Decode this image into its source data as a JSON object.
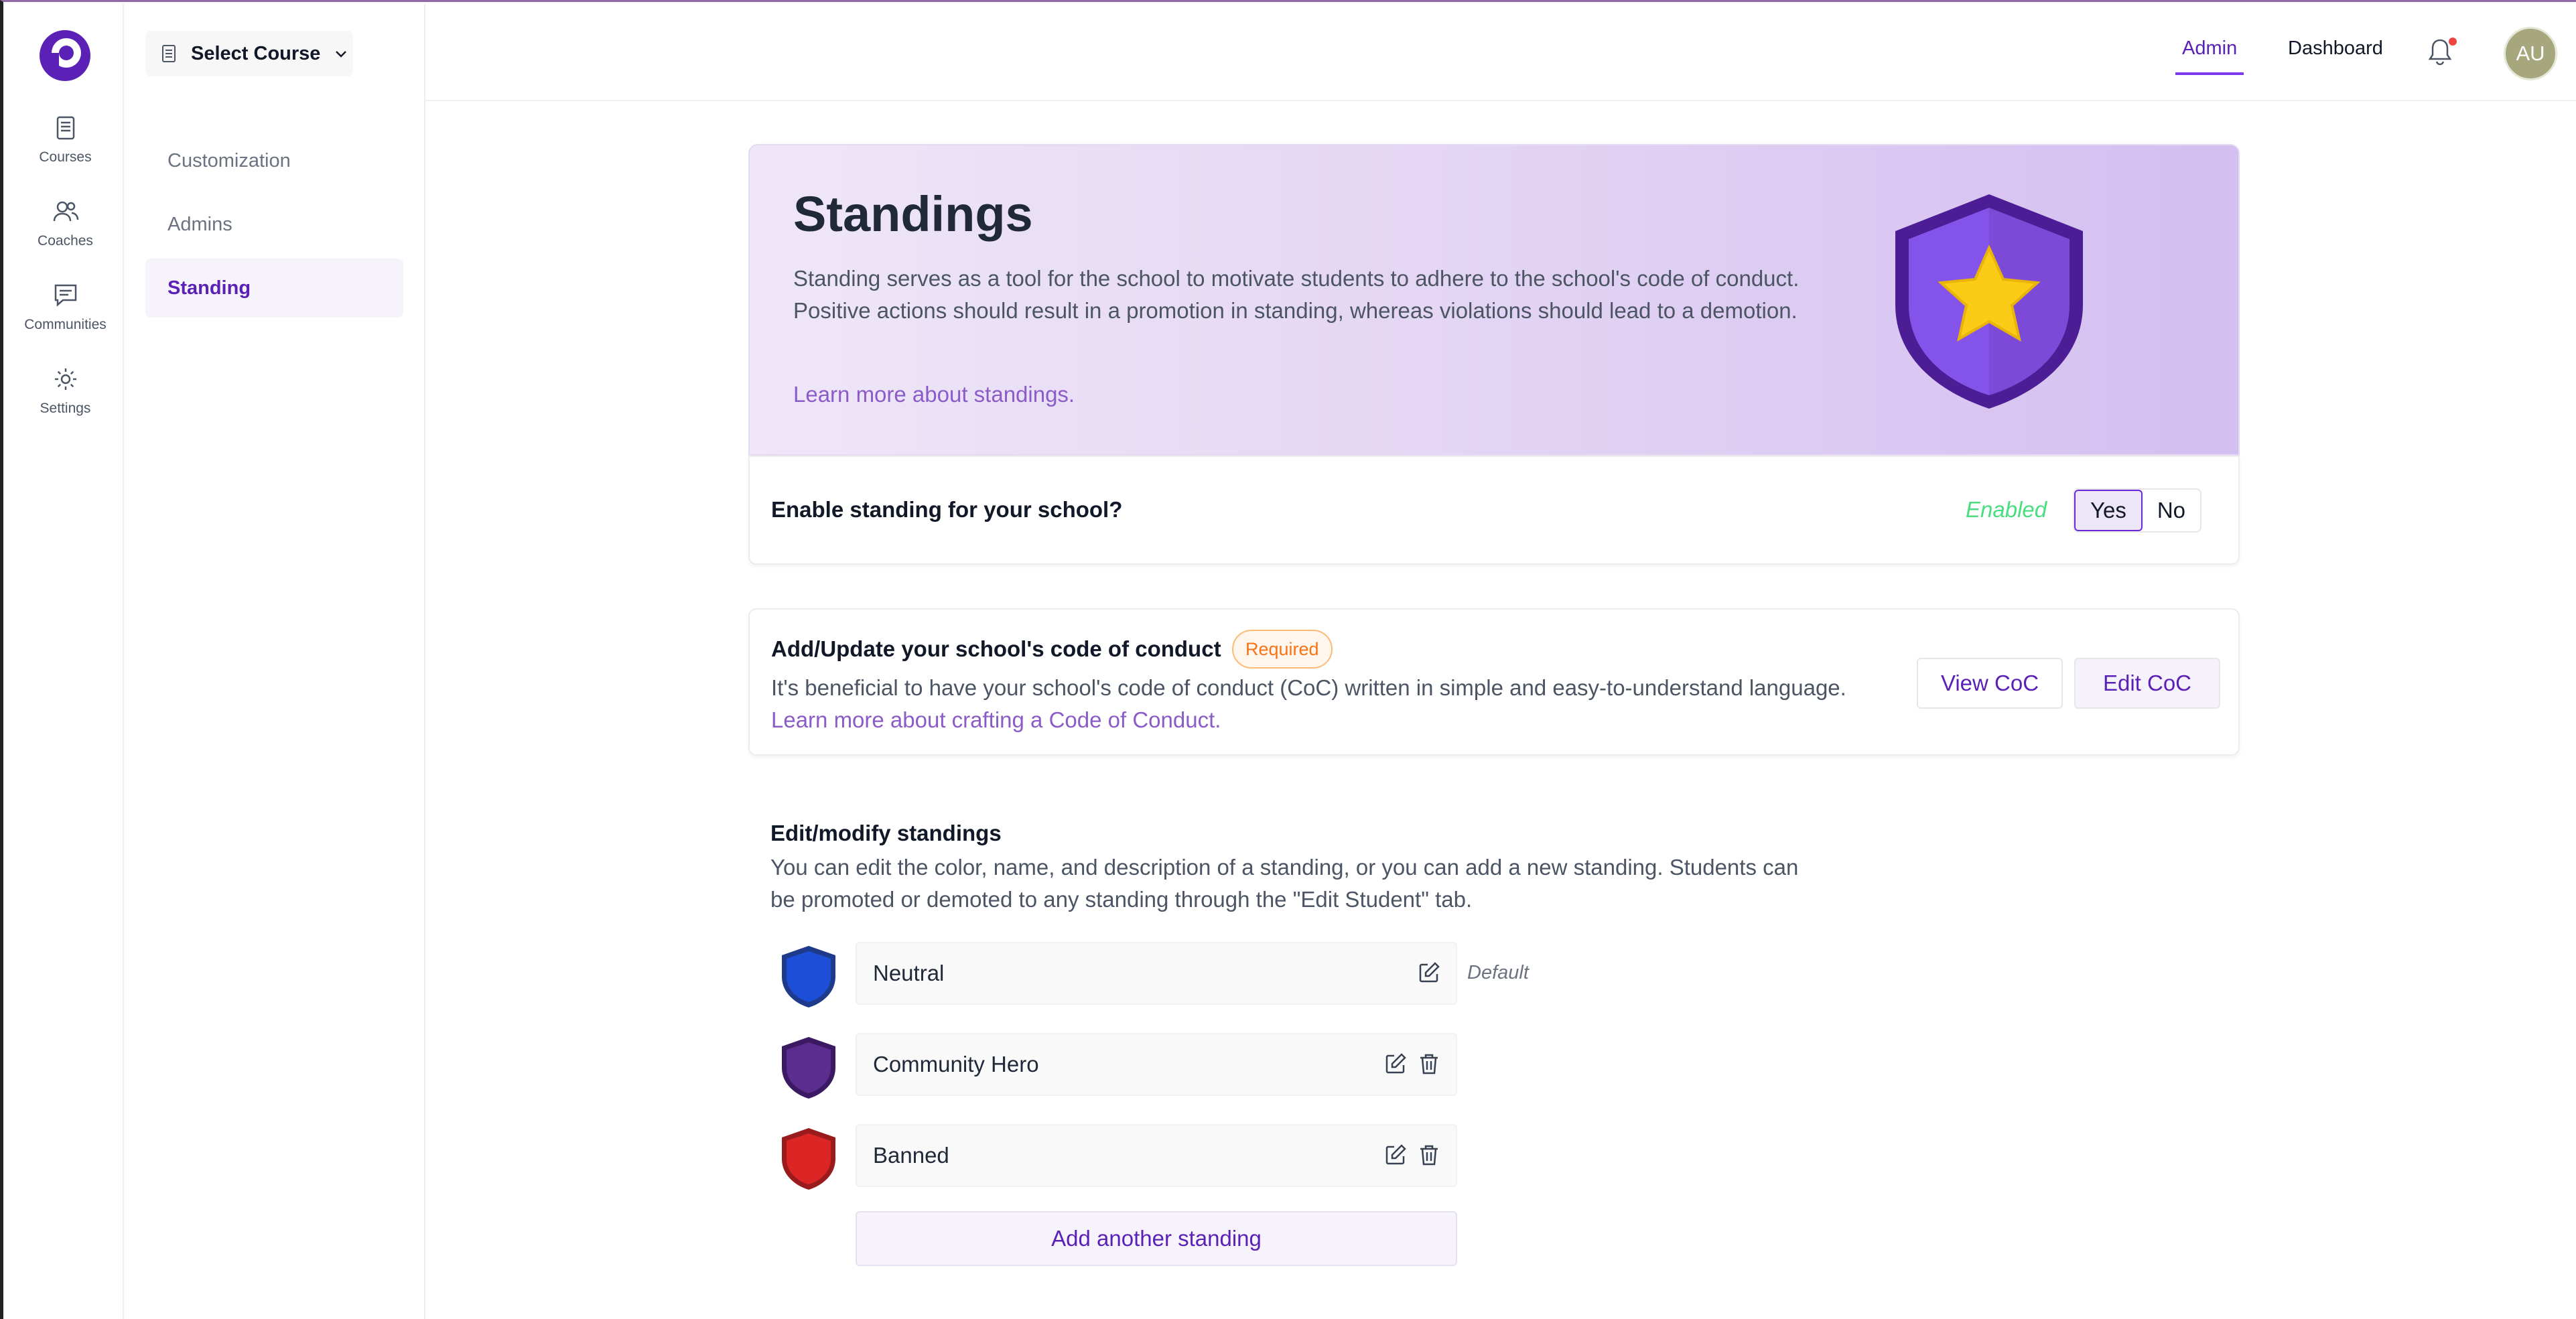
{
  "rail": {
    "items": [
      {
        "label": "Courses",
        "icon": "document-icon"
      },
      {
        "label": "Coaches",
        "icon": "users-icon"
      },
      {
        "label": "Communities",
        "icon": "chat-icon"
      },
      {
        "label": "Settings",
        "icon": "gear-icon"
      }
    ]
  },
  "subnav": {
    "course_select": "Select Course",
    "items": [
      {
        "label": "Customization"
      },
      {
        "label": "Admins"
      },
      {
        "label": "Standing",
        "active": true
      }
    ]
  },
  "header": {
    "tabs": [
      {
        "label": "Admin",
        "active": true
      },
      {
        "label": "Dashboard"
      }
    ],
    "avatar_initials": "AU"
  },
  "hero": {
    "title": "Standings",
    "description": "Standing serves as a tool for the school to motivate students to adhere to the school's code of conduct. Positive actions should result in a promotion in standing, whereas violations should lead to a demotion.",
    "link": "Learn more about standings."
  },
  "enable": {
    "label": "Enable standing for your school?",
    "status": "Enabled",
    "options": [
      "Yes",
      "No"
    ],
    "selected": "Yes"
  },
  "coc": {
    "title": "Add/Update your school's code of conduct",
    "badge": "Required",
    "description": "It's beneficial to have your school's code of conduct (CoC) written in simple and easy-to-understand language.",
    "link": "Learn more about crafting a Code of Conduct.",
    "view_button": "View CoC",
    "edit_button": "Edit CoC"
  },
  "standings": {
    "title": "Edit/modify standings",
    "description": "You can edit the color, name, and description of a standing, or you can add a new standing. Students can be promoted or demoted to any standing through the \"Edit Student\" tab.",
    "items": [
      {
        "name": "Neutral",
        "color": "#1d4ed8",
        "default_label": "Default"
      },
      {
        "name": "Community Hero",
        "color": "#5b2d8e"
      },
      {
        "name": "Banned",
        "color": "#dc2626"
      }
    ],
    "add_button": "Add another standing"
  },
  "colors": {
    "accent": "#5b21b6",
    "enabled": "#4ade80",
    "required_badge": "#f97316"
  }
}
